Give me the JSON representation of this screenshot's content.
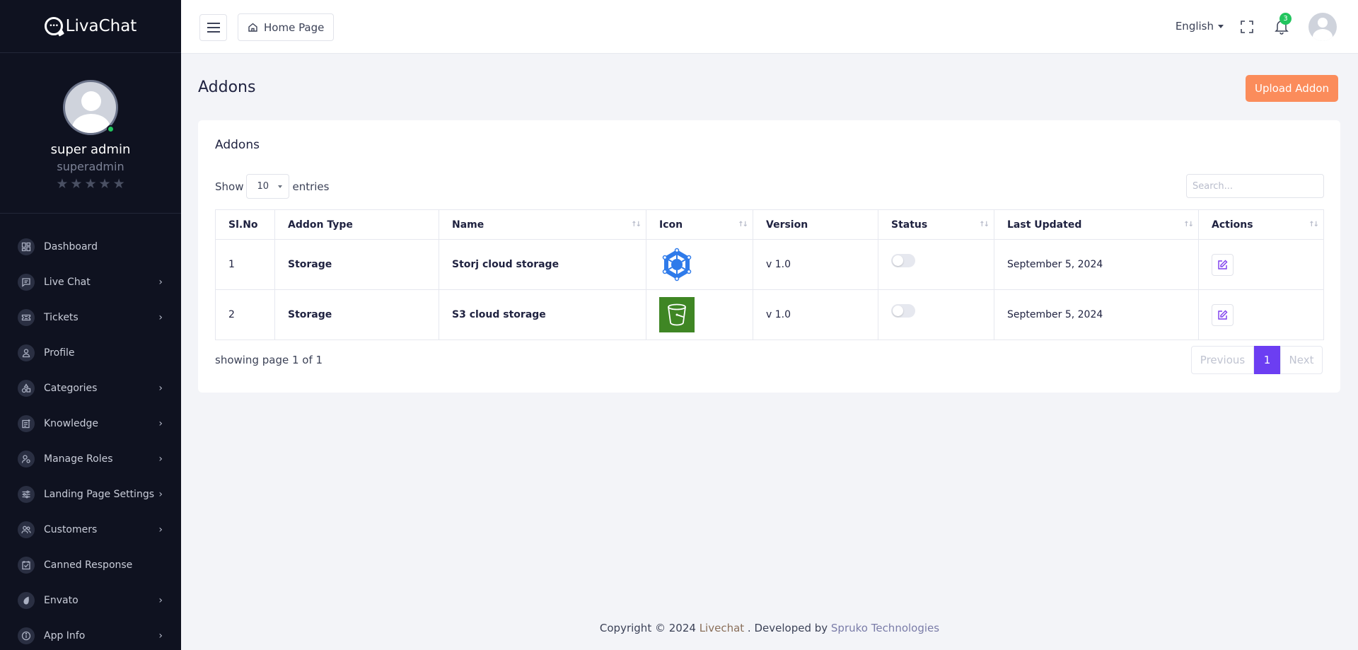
{
  "brand": {
    "name": "LivaChat"
  },
  "user": {
    "name": "super admin",
    "role": "superadmin",
    "rating": 0
  },
  "sidebar": {
    "items": [
      {
        "label": "Dashboard",
        "icon": "dashboard-icon",
        "has_submenu": false
      },
      {
        "label": "Live Chat",
        "icon": "chat-icon",
        "has_submenu": true
      },
      {
        "label": "Tickets",
        "icon": "ticket-icon",
        "has_submenu": true
      },
      {
        "label": "Profile",
        "icon": "user-icon",
        "has_submenu": false
      },
      {
        "label": "Categories",
        "icon": "categories-icon",
        "has_submenu": true
      },
      {
        "label": "Knowledge",
        "icon": "knowledge-icon",
        "has_submenu": true
      },
      {
        "label": "Manage Roles",
        "icon": "roles-icon",
        "has_submenu": true
      },
      {
        "label": "Landing Page Settings",
        "icon": "sliders-icon",
        "has_submenu": true
      },
      {
        "label": "Customers",
        "icon": "customers-icon",
        "has_submenu": true
      },
      {
        "label": "Canned Response",
        "icon": "canned-response-icon",
        "has_submenu": false
      },
      {
        "label": "Envato",
        "icon": "envato-icon",
        "has_submenu": true
      },
      {
        "label": "App Info",
        "icon": "info-icon",
        "has_submenu": true
      }
    ]
  },
  "header": {
    "home_label": "Home Page",
    "language": "English",
    "notification_count": "3"
  },
  "page": {
    "title": "Addons",
    "upload_button": "Upload Addon"
  },
  "card": {
    "title": "Addons",
    "show_label": "Show",
    "entries_label": "entries",
    "page_length": "10",
    "search_placeholder": "Search..."
  },
  "table": {
    "columns": [
      "Sl.No",
      "Addon Type",
      "Name",
      "Icon",
      "Version",
      "Status",
      "Last Updated",
      "Actions"
    ],
    "rows": [
      {
        "sl": "1",
        "type": "Storage",
        "name": "Storj cloud storage",
        "icon": "storj-icon",
        "version": "v 1.0",
        "status": false,
        "updated": "September 5, 2024"
      },
      {
        "sl": "2",
        "type": "Storage",
        "name": "S3 cloud storage",
        "icon": "s3-bucket-icon",
        "version": "v 1.0",
        "status": false,
        "updated": "September 5, 2024"
      }
    ]
  },
  "pagination": {
    "summary": "showing page 1 of 1",
    "previous": "Previous",
    "current": "1",
    "next": "Next"
  },
  "footer": {
    "prefix": "Copyright © 2024 ",
    "brand_link": "Livechat",
    "middle": " . Developed by ",
    "dev_link": "Spruko Technologies"
  },
  "colors": {
    "sidebar_bg": "#0f1220",
    "accent_orange": "#fb8c5b",
    "accent_purple": "#6c3ef2",
    "online_green": "#22c55e"
  }
}
